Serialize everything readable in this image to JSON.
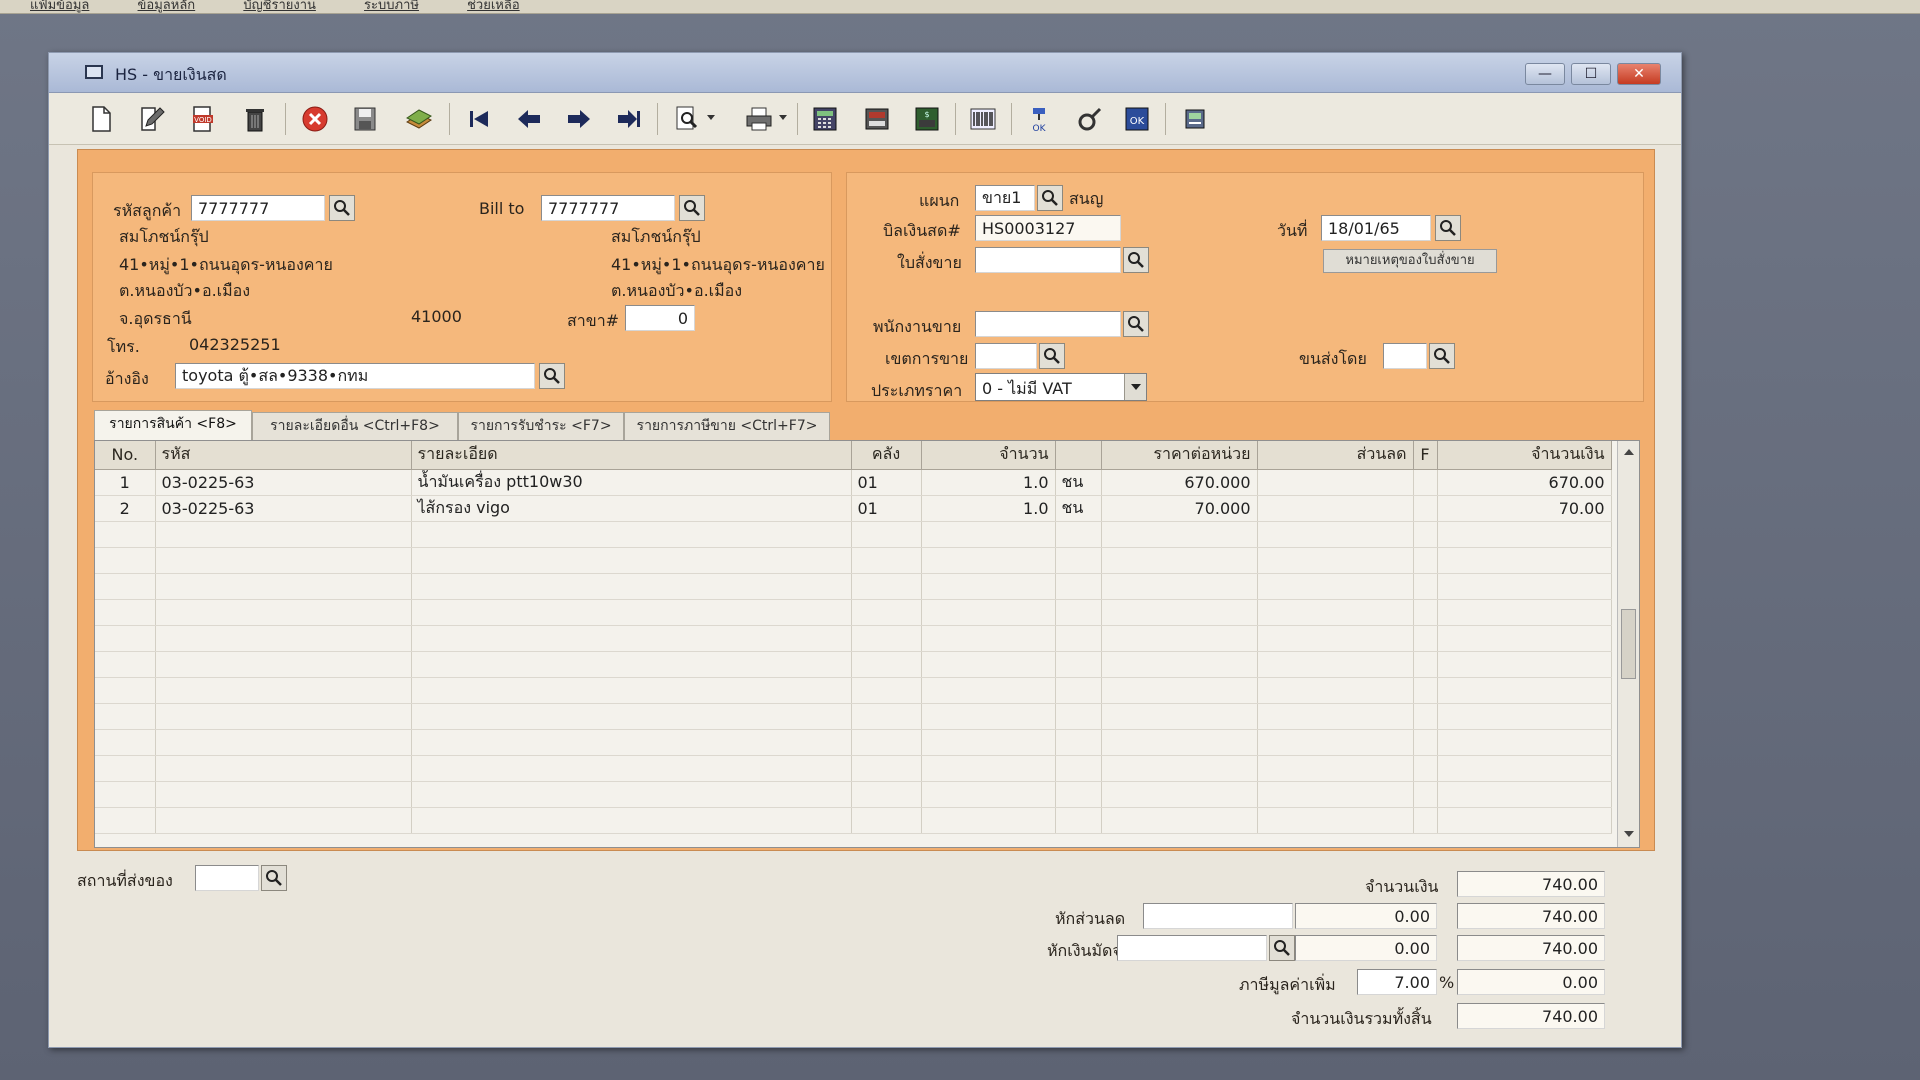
{
  "desktop": {
    "menubar_items": [
      "แฟ้มข้อมูล",
      "ข้อมูลหลัก",
      "บัญชีรายงาน",
      "ระบบภาษี",
      "ช่วยเหลือ"
    ]
  },
  "window": {
    "title": "HS - ขายเงินสด"
  },
  "toolbar": {
    "icons": [
      "new-document",
      "edit",
      "void",
      "delete",
      "cancel",
      "save",
      "copy-books",
      "first-record",
      "previous-record",
      "next-record",
      "last-record",
      "search",
      "print",
      "calculator",
      "register",
      "cash-drawer",
      "barcode",
      "approve",
      "tools",
      "confirm",
      "export"
    ]
  },
  "customer": {
    "code_label": "รหัสลูกค้า",
    "code_value": "7777777",
    "name": "สมโภชน์กรุ๊ป",
    "address1": "41•หมู่•1•ถนนอุดร-หนองคาย",
    "address2": "ต.หนองบัว•อ.เมือง",
    "address3": "จ.อุดรธานี",
    "postcode": "41000",
    "phone_label": "โทร.",
    "phone_value": "042325251",
    "ref_label": "อ้างอิง",
    "ref_value": "toyota ตู้•สล•9338•กทม",
    "branch_label": "สาขา#",
    "branch_value": "0"
  },
  "bill_to": {
    "label": "Bill to",
    "value": "7777777",
    "name": "สมโภชน์กรุ๊ป",
    "address1": "41•หมู่•1•ถนนอุดร-หนองคาย",
    "address2": "ต.หนองบัว•อ.เมือง"
  },
  "doc": {
    "dept_label": "แผนก",
    "dept_value": "ขาย1",
    "dept_name": "สนญ",
    "bill_label": "บิลเงินสด#",
    "bill_value": "HS0003127",
    "date_label": "วันที่",
    "date_value": "18/01/65",
    "order_label": "ใบสั่งขาย",
    "order_value": "",
    "order_note_button": "หมายเหตุของใบสั่งขาย",
    "salesman_label": "พนักงานขาย",
    "salesman_value": "",
    "area_label": "เขตการขาย",
    "area_value": "",
    "ship_by_label": "ขนส่งโดย",
    "ship_by_value": "",
    "price_type_label": "ประเภทราคา",
    "price_type_value": "0 - ไม่มี VAT"
  },
  "tabs": [
    {
      "label": "รายการสินค้า <F8>"
    },
    {
      "label": "รายละเอียดอื่น <Ctrl+F8>"
    },
    {
      "label": "รายการรับชำระ <F7>"
    },
    {
      "label": "รายการภาษีขาย <Ctrl+F7>"
    }
  ],
  "grid": {
    "headers": [
      "No.",
      "รหัส",
      "รายละเอียด",
      "คลัง",
      "จำนวน",
      "",
      "ราคาต่อหน่วย",
      "ส่วนลด",
      "F",
      "จำนวนเงิน"
    ],
    "rows": [
      {
        "no": "1",
        "code": "03-0225-63",
        "desc": "น้ำมันเครื่อง ptt10w30",
        "wh": "01",
        "qty": "1.0",
        "unit": "ชน",
        "price": "670.000",
        "disc": "",
        "f": "",
        "amount": "670.00"
      },
      {
        "no": "2",
        "code": "03-0225-63",
        "desc": "ไส้กรอง vigo",
        "wh": "01",
        "qty": "1.0",
        "unit": "ชน",
        "price": "70.000",
        "disc": "",
        "f": "",
        "amount": "70.00"
      }
    ]
  },
  "footer": {
    "ship_place_label": "สถานที่ส่งของ",
    "ship_place_value": "",
    "amount_label": "จำนวนเงิน",
    "amount_value": "740.00",
    "discount_label": "หักส่วนลด",
    "discount_text": "",
    "discount_amount": "0.00",
    "after_discount": "740.00",
    "deposit_label": "หักเงินมัดจำ",
    "deposit_text": "",
    "deposit_amount": "0.00",
    "after_deposit": "740.00",
    "vat_label": "ภาษีมูลค่าเพิ่ม",
    "vat_rate": "7.00",
    "vat_percent_sign": "%",
    "vat_amount": "0.00",
    "total_label": "จำนวนเงินรวมทั้งสิ้น",
    "total_value": "740.00"
  }
}
